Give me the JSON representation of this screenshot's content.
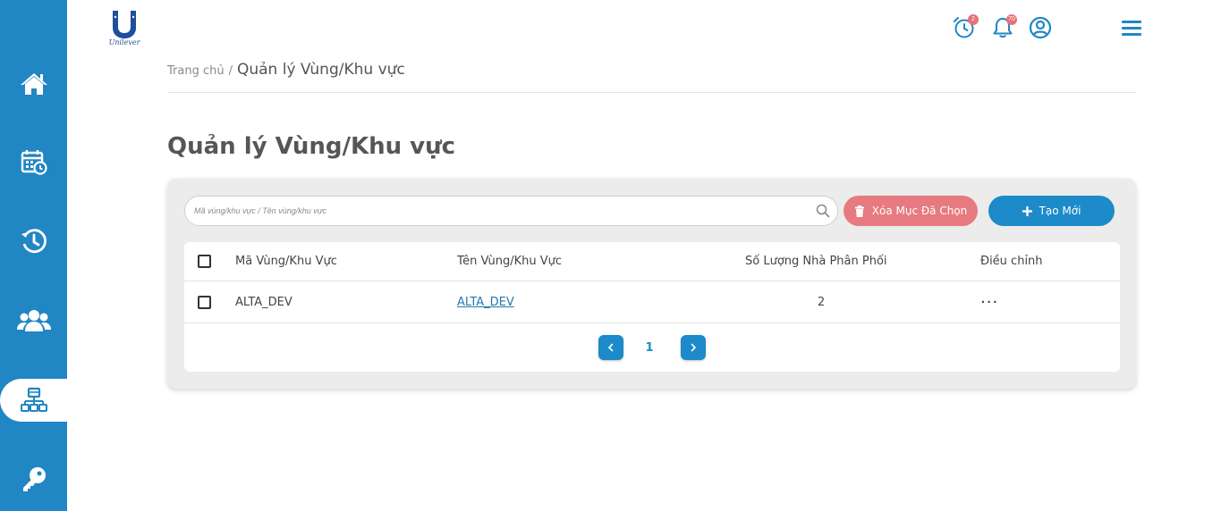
{
  "brand": {
    "logo_text": "Unilever"
  },
  "sidebar": {
    "items": [
      {
        "icon": "home-icon",
        "active": false
      },
      {
        "icon": "calendar-clock-icon",
        "active": false
      },
      {
        "icon": "history-icon",
        "active": false
      },
      {
        "icon": "users-icon",
        "active": false
      },
      {
        "icon": "sitemap-icon",
        "active": true
      },
      {
        "icon": "key-icon",
        "active": false
      }
    ]
  },
  "header": {
    "alarm_badge": "2",
    "notification_badge": "70",
    "account_icon": "user-circle-icon",
    "menu_icon": "hamburger-icon"
  },
  "breadcrumb": {
    "home": "Trang chủ",
    "separator": "/",
    "current": "Quản lý Vùng/Khu vực"
  },
  "page": {
    "title": "Quản lý Vùng/Khu vực"
  },
  "toolbar": {
    "search_placeholder": "Mã vùng/khu vực / Tên vùng/khu vực",
    "search_value": "",
    "delete_label": "Xóa Mục Đã Chọn",
    "create_label": "Tạo Mới"
  },
  "table": {
    "columns": [
      "Mã Vùng/Khu Vực",
      "Tên Vùng/Khu Vực",
      "Số Lượng Nhà Phân Phối",
      "Điều chỉnh"
    ],
    "rows": [
      {
        "code": "ALTA_DEV",
        "name": "ALTA_DEV",
        "distributor_count": "2",
        "actions": "···"
      }
    ]
  },
  "pagination": {
    "current_page": "1"
  },
  "colors": {
    "primary": "#2186c4",
    "danger": "#e77a80",
    "button_blue": "#1d8ac9",
    "badge": "#e9707a"
  }
}
